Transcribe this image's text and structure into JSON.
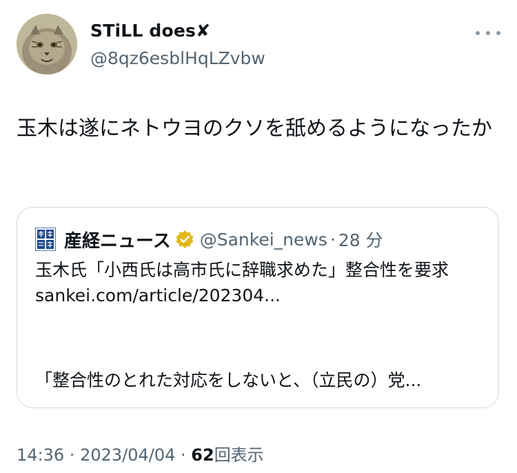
{
  "author": {
    "display_name": "STiLL does✘",
    "handle": "@8qz6esblHqLZvbw"
  },
  "tweet": {
    "text": "玉木は遂にネトウヨのクソを舐めるようになったか"
  },
  "quote": {
    "logo_text": "産経",
    "name": "産経ニュース",
    "handle": "@Sankei_news",
    "separator": "·",
    "time": "28 分",
    "headline": "玉木氏「小西氏は高市氏に辞職求めた」整合性を要求",
    "link": "sankei.com/article/202304...",
    "excerpt": "「整合性のとれた対応をしないと、（立民の）党..."
  },
  "meta": {
    "time": "14:36",
    "sep1": " · ",
    "date": "2023/04/04",
    "sep2": " · ",
    "views_count": "62",
    "views_label": "回表示"
  },
  "colors": {
    "text": "#0f1419",
    "secondary": "#536471",
    "border": "#cfd9de",
    "verified_gold": "#e2b719"
  },
  "icons": {
    "more": "more-dots-icon",
    "verified": "verified-badge-icon",
    "logo": "sankei-logo-icon"
  }
}
